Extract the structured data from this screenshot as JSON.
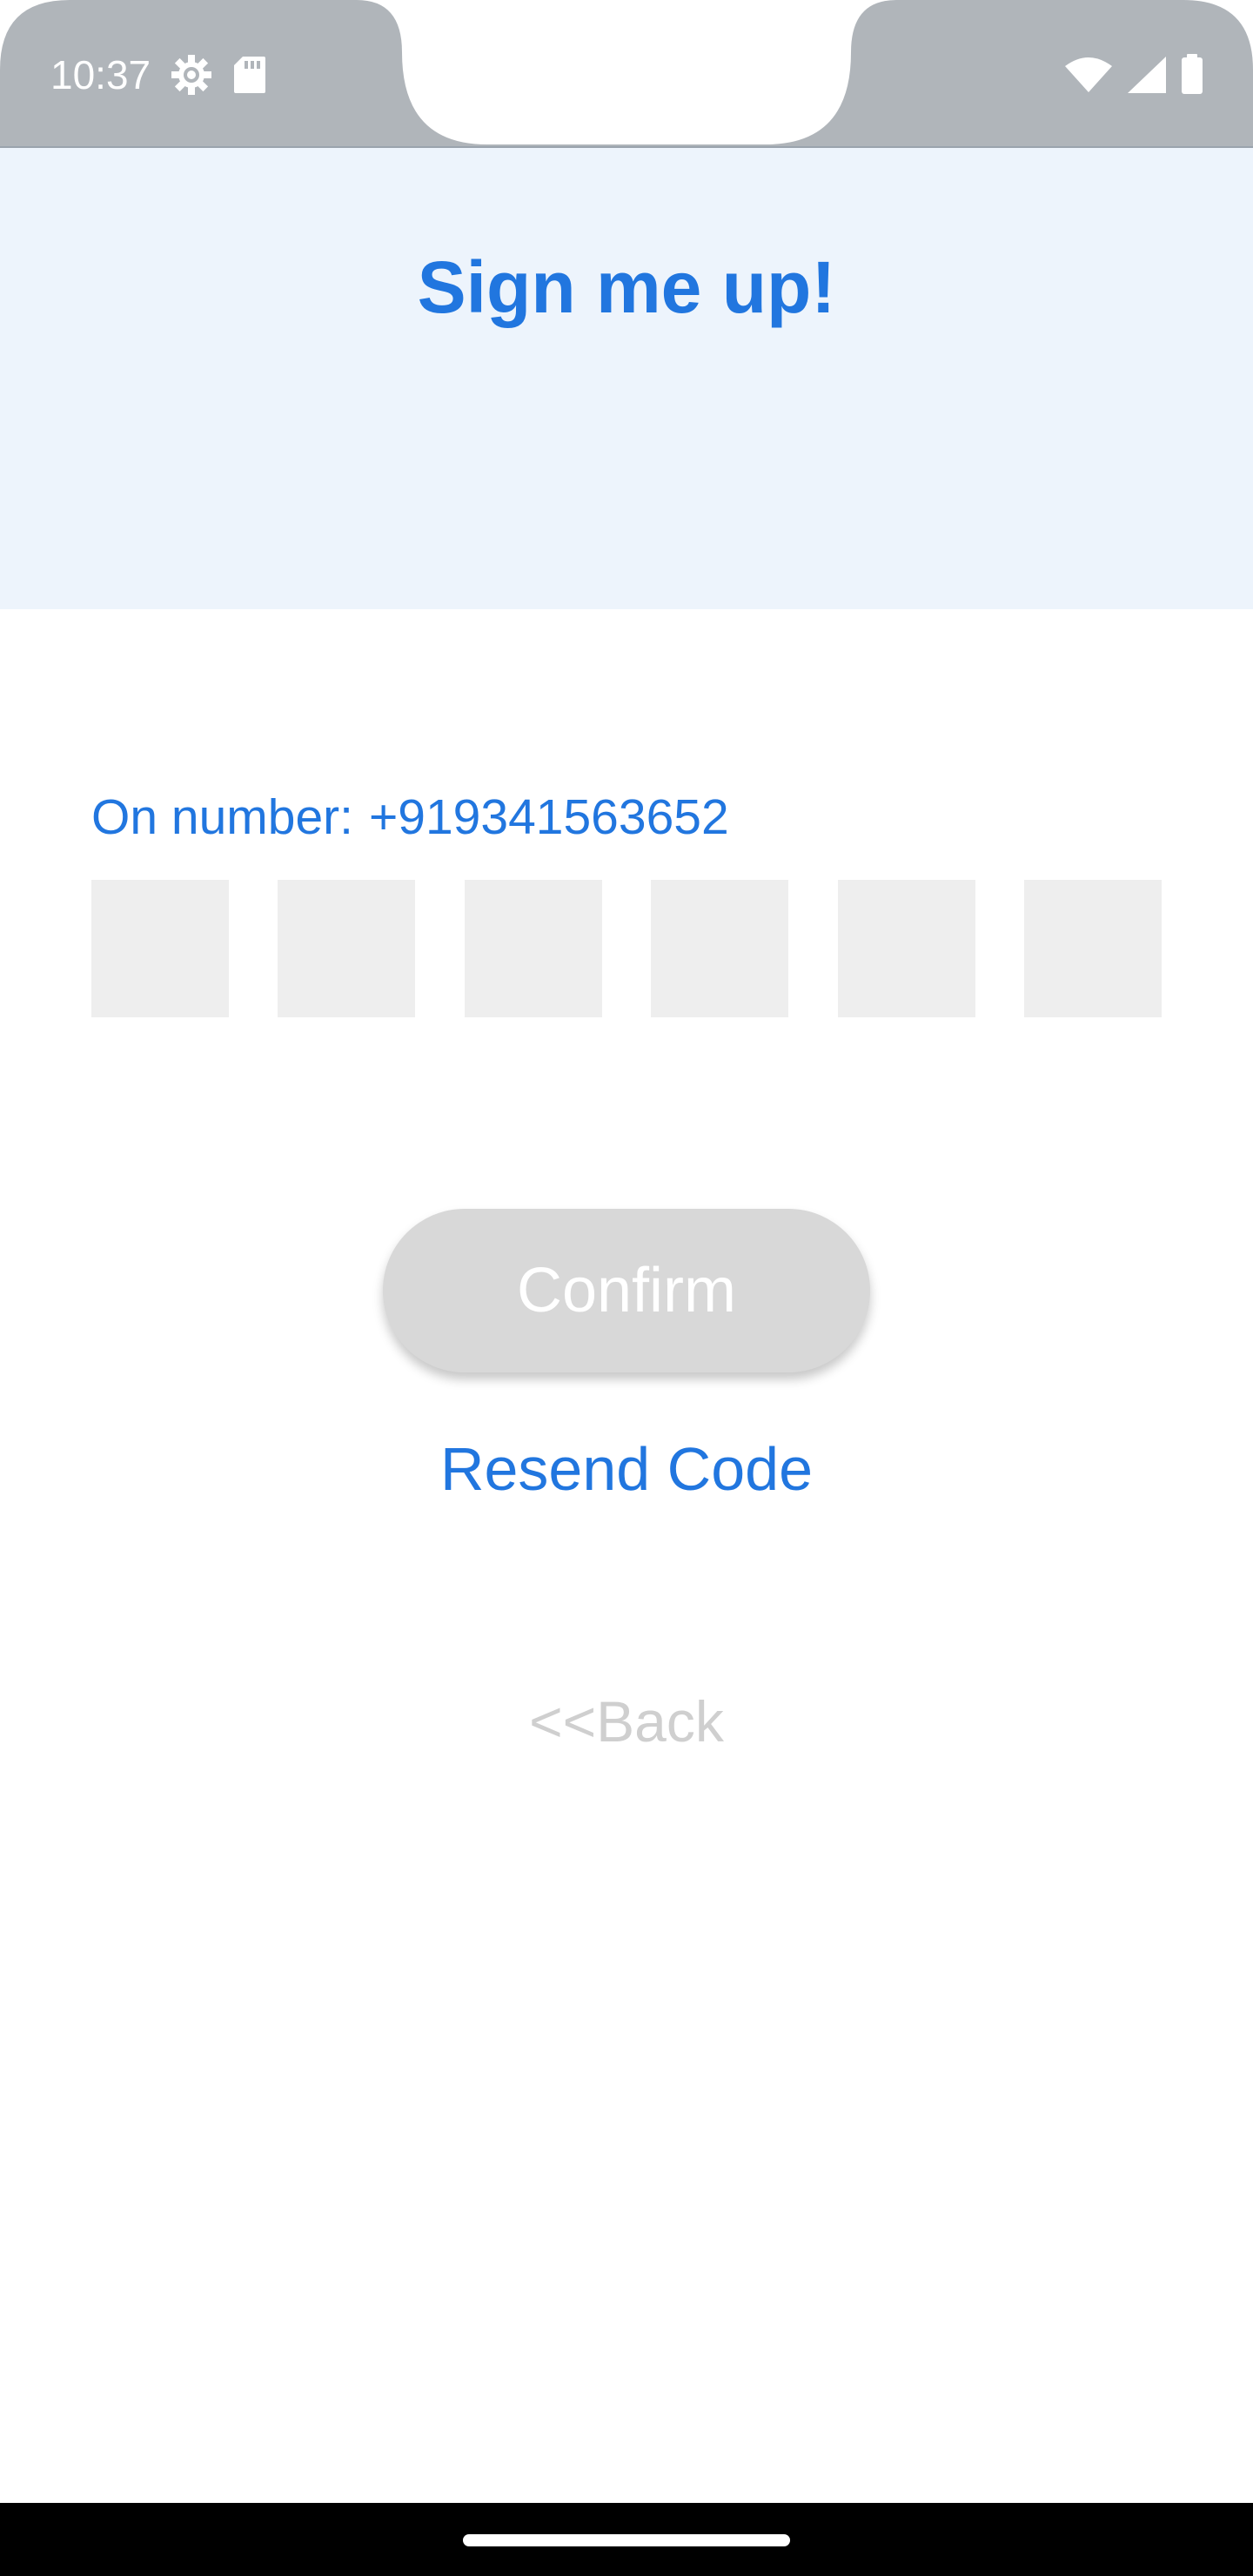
{
  "status_bar": {
    "time": "10:37",
    "left_icons": [
      "settings-icon",
      "sd-card-icon"
    ],
    "right_icons": [
      "wifi-icon",
      "cellular-signal-icon",
      "battery-icon"
    ],
    "background_color": "#b0b5ba"
  },
  "header": {
    "title": "Sign me up!",
    "background_color": "#edf4fc",
    "title_color": "#2176df"
  },
  "verification": {
    "number_prefix": "On number:",
    "phone_number": "+919341563652",
    "code_boxes": [
      {
        "value": ""
      },
      {
        "value": ""
      },
      {
        "value": ""
      },
      {
        "value": ""
      },
      {
        "value": ""
      },
      {
        "value": ""
      }
    ]
  },
  "actions": {
    "confirm_label": "Confirm",
    "confirm_enabled": false,
    "resend_label": "Resend Code",
    "back_label": "<<Back"
  },
  "colors": {
    "accent": "#2176df",
    "disabled_button": "#d8d8d8",
    "otp_box": "#eeeeee",
    "back_text": "#cfcfcf"
  }
}
